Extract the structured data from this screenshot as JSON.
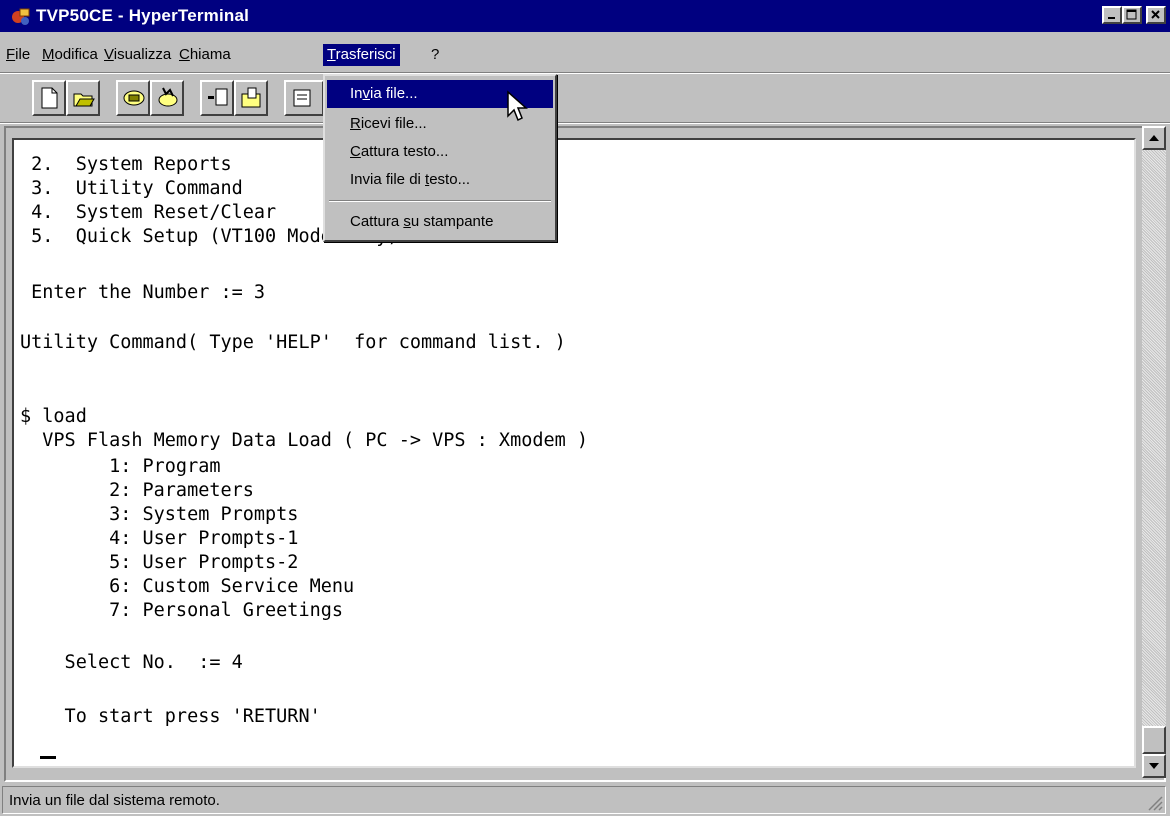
{
  "window": {
    "title": "TVP50CE - HyperTerminal",
    "controls": [
      "minimize",
      "maximize",
      "close"
    ]
  },
  "menubar": {
    "items": [
      {
        "id": "file",
        "label": "File"
      },
      {
        "id": "modifica",
        "label": "Modifica"
      },
      {
        "id": "visualizza",
        "label": "Visualizza"
      },
      {
        "id": "chiama",
        "label": "Chiama"
      },
      {
        "id": "trasferisci",
        "label": "Trasferisci",
        "active": true
      },
      {
        "id": "help",
        "label": "?"
      }
    ]
  },
  "toolbar": {
    "buttons": [
      "new-icon",
      "open-icon",
      "connect-icon",
      "disconnect-icon",
      "send-icon",
      "receive-icon",
      "properties-icon"
    ]
  },
  "transfer_menu": {
    "items": [
      {
        "label": "Invia file...",
        "highlighted": true
      },
      {
        "label": "Ricevi file..."
      },
      {
        "label": "Cattura testo..."
      },
      {
        "label": "Invia file di testo..."
      },
      {
        "label": "Cattura su stampante"
      }
    ]
  },
  "terminal": {
    "lines": [
      " 2.  System Reports",
      " 3.  Utility Command",
      " 4.  System Reset/Clear",
      " 5.  Quick Setup (VT100 Mode Only)",
      "",
      " Enter the Number := 3",
      "",
      "Utility Command( Type 'HELP'  for command list. )",
      "",
      "",
      "$ load",
      "  VPS Flash Memory Data Load ( PC -> VPS : Xmodem )",
      "        1: Program",
      "        2: Parameters",
      "        3: System Prompts",
      "        4: User Prompts-1",
      "        5: User Prompts-2",
      "        6: Custom Service Menu",
      "        7: Personal Greetings",
      "",
      "    Select No.  := 4",
      "",
      "    To start press 'RETURN'"
    ]
  },
  "statusbar": {
    "text": "Invia un file dal sistema remoto."
  },
  "colors": {
    "titlebar": "#000080",
    "face": "#c0c0c0",
    "highlight": "#000080"
  }
}
